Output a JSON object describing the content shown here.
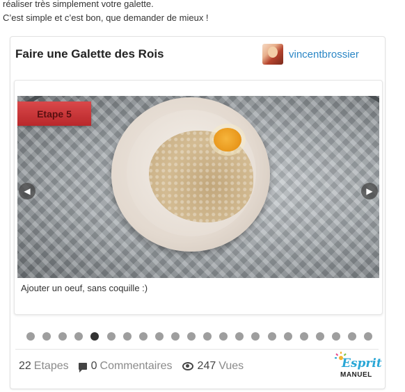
{
  "intro": {
    "line1": "réaliser très simplement votre galette.",
    "line2": "C’est simple et c’est bon, que demander de mieux !"
  },
  "card": {
    "title": "Faire une Galette des Rois",
    "author": "vincentbrossier",
    "slide": {
      "step_label": "Etape 5",
      "caption": "Ajouter un oeuf, sans coquille :)",
      "prev_icon": "chevron-left-icon",
      "next_icon": "chevron-right-icon"
    },
    "pagination": {
      "total": 22,
      "active": 5
    },
    "stats": {
      "steps_count": "22",
      "steps_label": "Etapes",
      "comments_count": "0",
      "comments_label": "Commentaires",
      "views_count": "247",
      "views_label": "Vues"
    },
    "logo": {
      "word": "Esprit",
      "sub": "MANUEL"
    }
  },
  "colors": {
    "link": "#2a86c5",
    "badge": "#c9373a",
    "dot": "#9e9e9e",
    "dot_active": "#333333",
    "logo_blue": "#2aa7d6"
  }
}
